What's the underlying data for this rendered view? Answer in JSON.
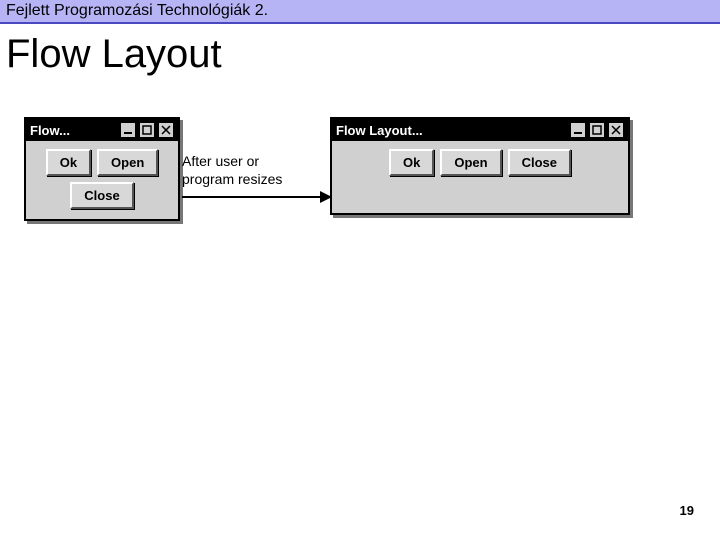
{
  "header": "Fejlett Programozási Technológiák 2.",
  "title": "Flow Layout",
  "page_number": "19",
  "caption_line1": "After user or",
  "caption_line2": "program resizes",
  "window_narrow": {
    "title": "Flow...",
    "buttons": {
      "ok": "Ok",
      "open": "Open",
      "close": "Close"
    }
  },
  "window_wide": {
    "title": "Flow Layout...",
    "buttons": {
      "ok": "Ok",
      "open": "Open",
      "close": "Close"
    }
  }
}
